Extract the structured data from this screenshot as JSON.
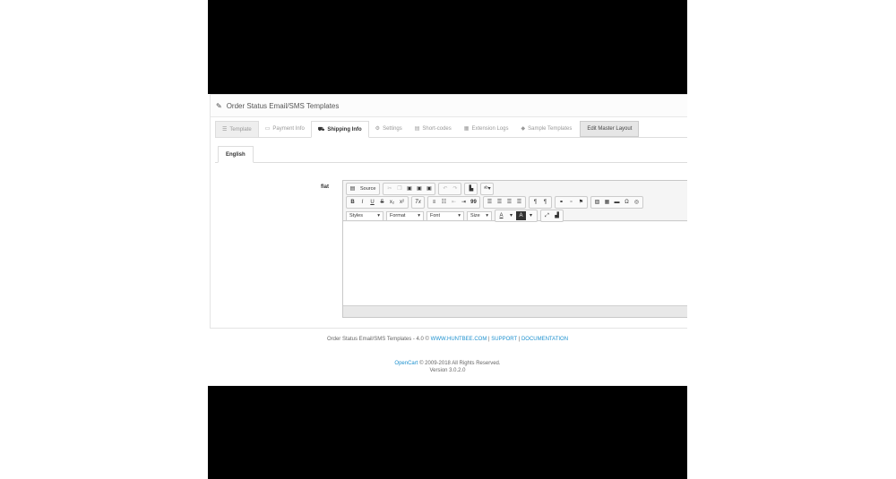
{
  "panel": {
    "title": "Order Status Email/SMS Templates"
  },
  "tabs": [
    {
      "label": "Template",
      "icon": "list-icon"
    },
    {
      "label": "Payment Info",
      "icon": "credit-card-icon"
    },
    {
      "label": "Shipping Info",
      "icon": "truck-icon"
    },
    {
      "label": "Settings",
      "icon": "gears-icon"
    },
    {
      "label": "Short-codes",
      "icon": "book-icon"
    },
    {
      "label": "Extension Logs",
      "icon": "calendar-icon"
    },
    {
      "label": "Sample Templates",
      "icon": "tag-icon"
    },
    {
      "label": "Edit Master Layout",
      "icon": ""
    }
  ],
  "active_tab": "Shipping Info",
  "language_tab": "English",
  "field_label": "flat",
  "editor": {
    "source_label": "Source",
    "combos": {
      "styles": "Styles",
      "format": "Format",
      "font": "Font",
      "size": "Size"
    },
    "buttons": {
      "bold": "B",
      "italic": "I",
      "underline": "U",
      "strike": "S",
      "subscript": "x₂",
      "superscript": "x²",
      "removeformat": "Tx",
      "blockquote": "99",
      "font_color": "A",
      "bg_color": "A",
      "omega": "Ω"
    }
  },
  "footer": {
    "line1_text": "Order Status Email/SMS Templates - 4.0 ©",
    "site_link": "WWW.HUNTBEE.COM",
    "sep1": "|",
    "support_link": "SUPPORT",
    "sep2": "|",
    "docs_link": "DOCUMENTATION",
    "opencart_link": "OpenCart",
    "copyright": "© 2009-2018 All Rights Reserved.",
    "version": "Version 3.0.2.0"
  }
}
